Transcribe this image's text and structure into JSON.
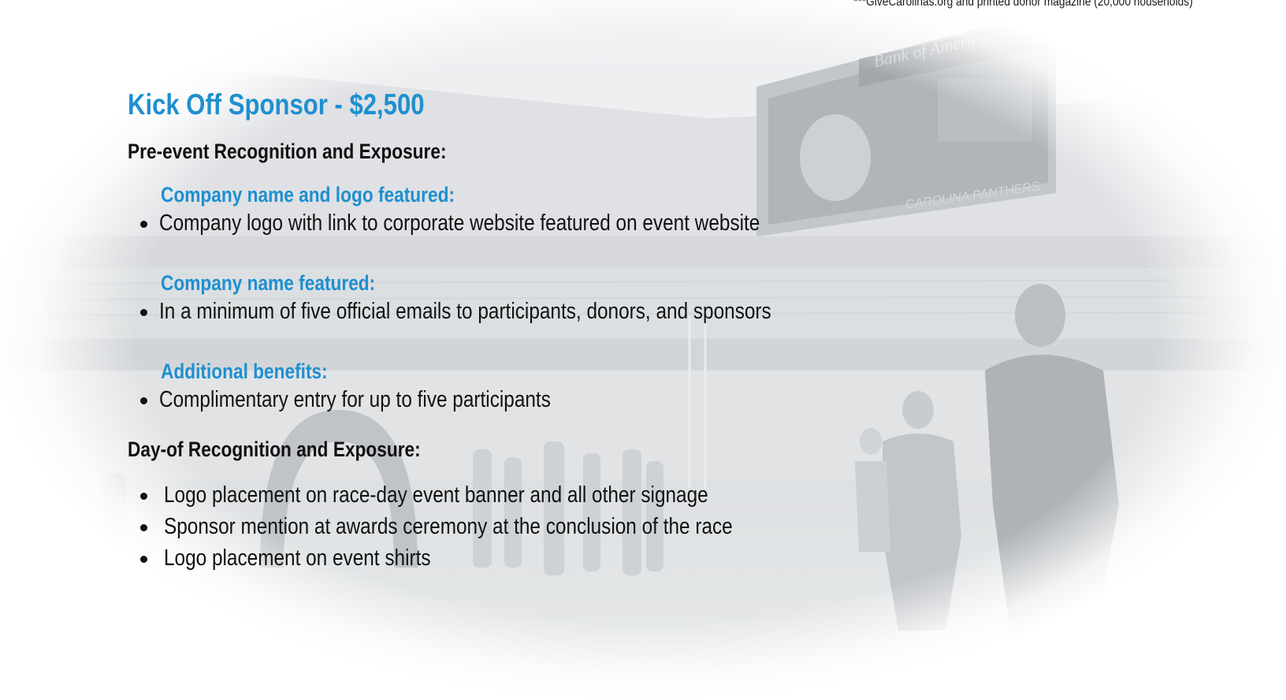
{
  "footnote": "***GiveCarolinas.org and printed donor magazine (20,000 households)",
  "sponsor": {
    "title": "Kick Off Sponsor - $2,500"
  },
  "pre_event": {
    "heading": "Pre-event Recognition and Exposure:",
    "sections": [
      {
        "subheading": "Company name and logo featured:",
        "items": [
          "Company logo with link to corporate website featured on event website"
        ]
      },
      {
        "subheading": "Company name featured:",
        "items": [
          "In a minimum of five official emails to participants, donors, and sponsors"
        ]
      },
      {
        "subheading": "Additional benefits:",
        "items": [
          "Complimentary entry for up to five participants"
        ]
      }
    ]
  },
  "day_of": {
    "heading": "Day-of Recognition and Exposure:",
    "items": [
      "Logo placement on race-day event banner and all other signage",
      "Sponsor mention at awards ceremony at the conclusion of the race",
      "Logo placement on event shirts"
    ]
  },
  "background": {
    "scoreboard_text": "Bank of America",
    "banner_text": "CAROLINA PANTHERS",
    "colors": {
      "accent_blue": "#1e8fd0",
      "body_text": "#111111",
      "photo_tone": "#c9cdd1"
    }
  }
}
